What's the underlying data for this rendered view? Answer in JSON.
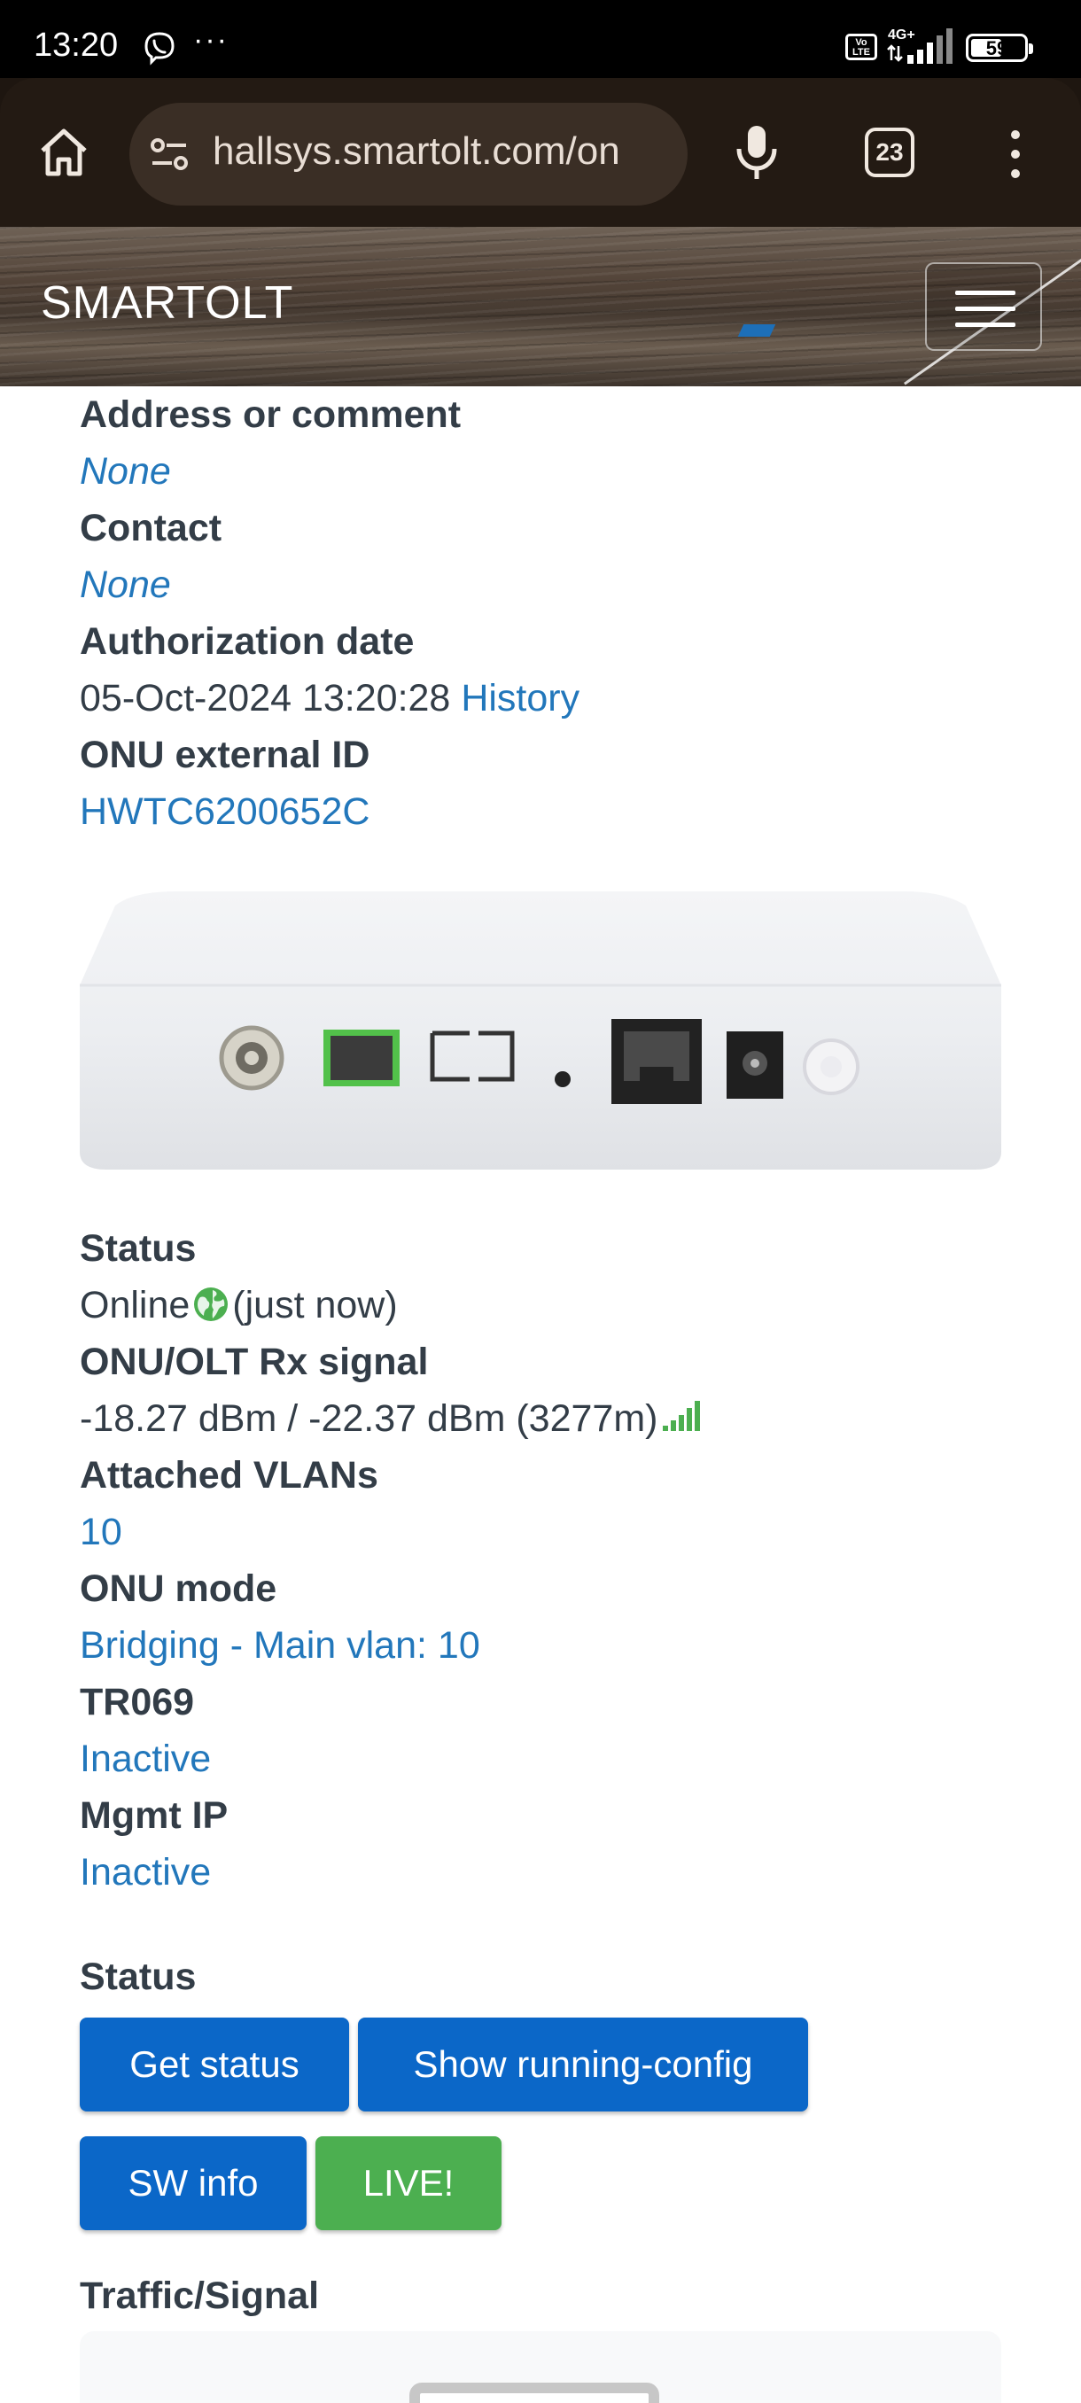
{
  "status_bar": {
    "time": "13:20",
    "more": "···",
    "volte_line1": "Vo",
    "volte_line2": "LTE",
    "network": "4G+",
    "battery": "59"
  },
  "browser": {
    "url": "hallsys.smartolt.com/on",
    "tab_count": "23"
  },
  "header": {
    "brand": "SMARTOLT"
  },
  "details": {
    "address_label": "Address or comment",
    "address_value": "None",
    "contact_label": "Contact",
    "contact_value": "None",
    "auth_date_label": "Authorization date",
    "auth_date_value": "05-Oct-2024 13:20:28",
    "auth_date_history": "History",
    "external_id_label": "ONU external ID",
    "external_id_value": "HWTC6200652C",
    "status_label": "Status",
    "status_online": "Online",
    "status_time": "(just now)",
    "rx_label": "ONU/OLT Rx signal",
    "rx_value": "-18.27 dBm / -22.37 dBm (3277m)",
    "vlans_label": "Attached VLANs",
    "vlans_value": "10",
    "mode_label": "ONU mode",
    "mode_value": "Bridging - Main vlan: 10",
    "tr069_label": "TR069",
    "tr069_value": "Inactive",
    "mgmt_label": "Mgmt IP",
    "mgmt_value": "Inactive"
  },
  "actions": {
    "section_label": "Status",
    "get_status": "Get status",
    "show_running_config": "Show running-config",
    "sw_info": "SW info",
    "live": "LIVE!"
  },
  "traffic": {
    "label": "Traffic/Signal"
  },
  "colors": {
    "link": "#2277bb",
    "button_blue": "#0b67c8",
    "button_green": "#4caf50",
    "online_green": "#4caf50"
  }
}
